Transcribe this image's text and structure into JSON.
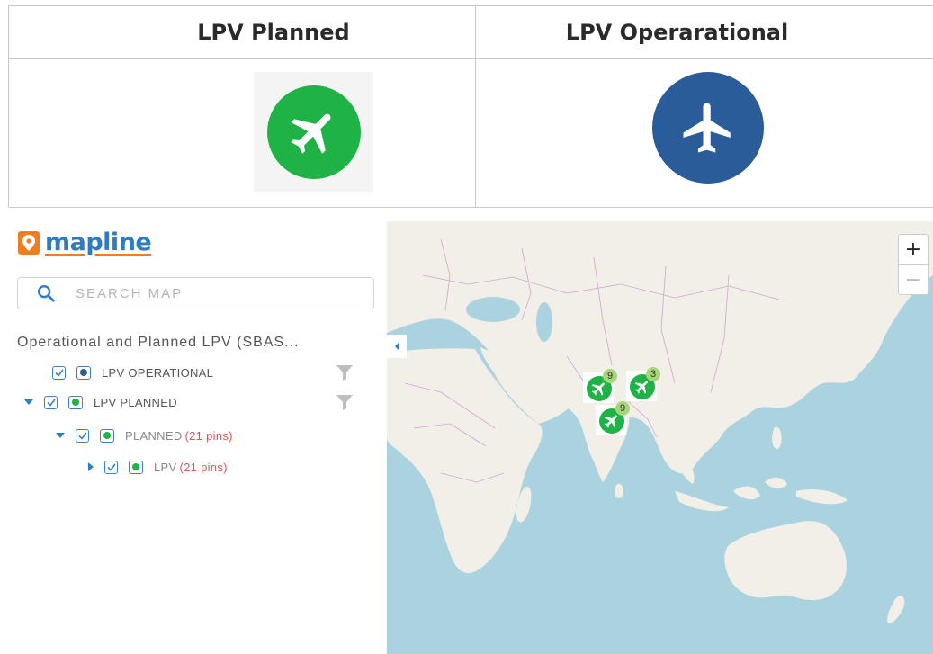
{
  "legend": {
    "columns": [
      {
        "header": "LPV Planned",
        "icon": "airplane-icon",
        "color": "#1fb247"
      },
      {
        "header": "LPV Operarational",
        "icon": "airplane-icon",
        "color": "#295c98"
      }
    ]
  },
  "app": {
    "logo_text": "mapline",
    "search": {
      "placeholder": "SEARCH MAP",
      "value": ""
    },
    "layer_title": "Operational and Planned LPV (SBAS...",
    "layers": [
      {
        "label": "LPV OPERATIONAL",
        "checked": true,
        "icon_color": "#295c98"
      },
      {
        "label": "LPV PLANNED",
        "checked": true,
        "icon_color": "#1fb247",
        "expanded": true
      },
      {
        "label": "PLANNED",
        "pins": "(21 pins)",
        "checked": true,
        "expanded": true
      },
      {
        "label": "LPV",
        "pins": "(21 pins)",
        "checked": true,
        "expanded": false
      }
    ]
  },
  "map": {
    "zoom_in": "+",
    "zoom_out": "−",
    "clusters": [
      {
        "count": "9"
      },
      {
        "count": "3"
      },
      {
        "count": "9"
      }
    ],
    "colors": {
      "water": "#aad3df",
      "land": "#f2efe9",
      "border": "#d4a3d4"
    }
  }
}
